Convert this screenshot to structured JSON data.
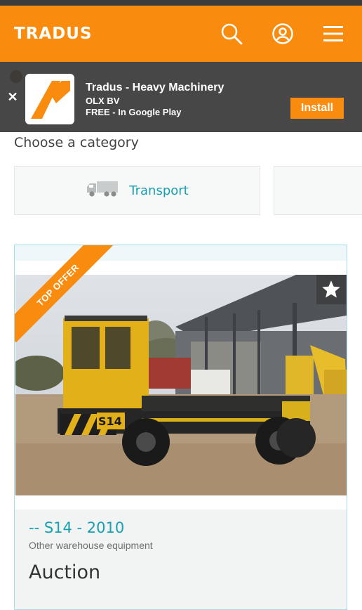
{
  "header": {
    "logo_text": "TRADUS",
    "icons": [
      "search-icon",
      "account-icon",
      "menu-icon"
    ],
    "brand_color": "#f98b0e"
  },
  "app_banner": {
    "title": "Tradus - Heavy Machinery",
    "publisher": "OLX BV",
    "price_note": "FREE - In Google Play",
    "install_label": "Install",
    "close_label": "✕"
  },
  "categories": {
    "heading": "Choose a category",
    "items": [
      {
        "label": "Transport",
        "icon": "truck-icon"
      }
    ]
  },
  "listing": {
    "badge": "TOP OFFER",
    "title": "-- S14 - 2010",
    "category": "Other warehouse equipment",
    "price": "Auction",
    "photo_text": "S14",
    "accent_color": "#1a9fb2"
  }
}
